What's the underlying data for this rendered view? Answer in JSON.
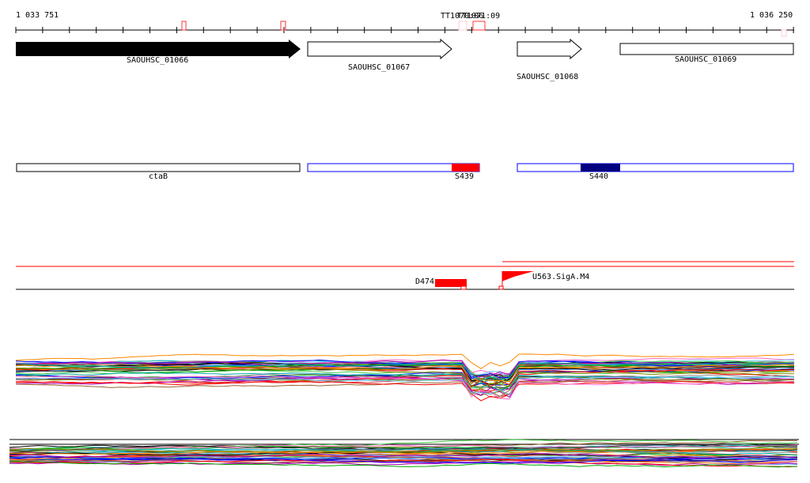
{
  "ruler": {
    "start": "1 033 751",
    "end": "1 036 250",
    "labels": [
      "TT1070:06",
      "TT1071:09"
    ]
  },
  "genes": [
    {
      "name": "SAOUHSC_01066",
      "filled": true
    },
    {
      "name": "SAOUHSC_01067",
      "filled": false
    },
    {
      "name": "SAOUHSC_01068",
      "filled": false
    },
    {
      "name": "SAOUHSC_01069",
      "filled": false
    }
  ],
  "transcripts": [
    {
      "name": "ctaB"
    },
    {
      "name": "S439",
      "color": "#ff0000"
    },
    {
      "name": "S440",
      "color": "#000080"
    }
  ],
  "features": [
    {
      "name": "D474"
    },
    {
      "name": "U563.SigA.M4"
    }
  ],
  "colors": {
    "accent": "#ff0000",
    "navy": "#000080"
  }
}
